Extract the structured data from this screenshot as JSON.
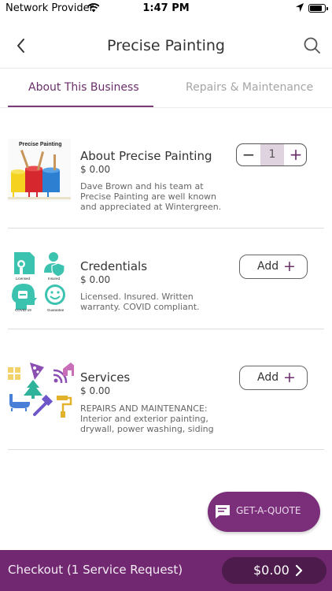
{
  "status_bar": {
    "carrier": "Network Provider",
    "time": "1:47 PM"
  },
  "nav": {
    "title": "Precise Painting"
  },
  "tabs": [
    {
      "label": "About This Business",
      "active": true
    },
    {
      "label": "Repairs & Maintenance",
      "active": false
    }
  ],
  "items": [
    {
      "image_caption": "Precise Painting",
      "title": "About Precise Painting",
      "price": "$ 0.00",
      "description": [
        "Dave Brown and his team at",
        "Precise Painting are well known",
        "and appreciated at Wintergreen."
      ],
      "quantity": "1"
    },
    {
      "image_labels": [
        "Licensed",
        "Insured",
        "COVID-19",
        "Guarantee"
      ],
      "title": "Credentials",
      "price": "$ 0.00",
      "description": [
        "Licensed. Insured. Written",
        "warranty. COVID compliant."
      ],
      "button_label": "Add"
    },
    {
      "title": "Services",
      "price": "$ 0.00",
      "description": [
        "REPAIRS AND MAINTENANCE:",
        "Interior and exterior painting,",
        "drywall, power washing, siding"
      ],
      "button_label": "Add"
    }
  ],
  "fab": {
    "label": "GET-A-QUOTE"
  },
  "checkout": {
    "label": "Checkout (1 Service Request)",
    "total": "$0.00"
  },
  "colors": {
    "brand": "#722871",
    "brand_dark": "#4d1b4c",
    "accent_text": "#6b2f6b",
    "teal": "#3cc3b0"
  },
  "icons": [
    "wifi-icon",
    "location-icon",
    "battery-icon",
    "back-chevron-icon",
    "search-icon",
    "chat-icon",
    "chevron-right-icon"
  ]
}
